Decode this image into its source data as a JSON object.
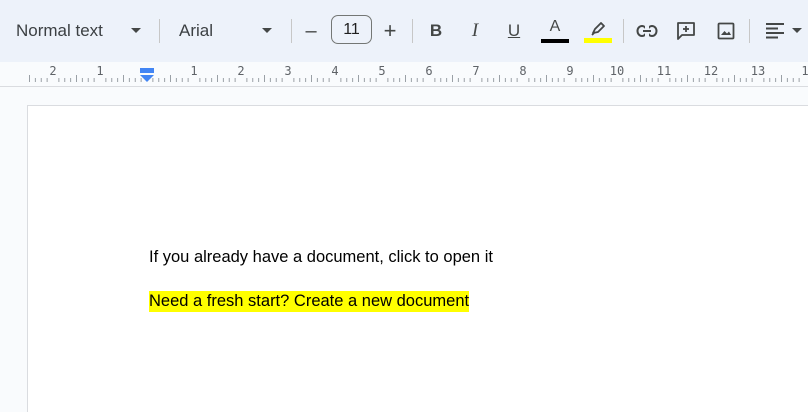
{
  "toolbar": {
    "style_dropdown": {
      "label": "Normal text"
    },
    "font_dropdown": {
      "label": "Arial"
    },
    "font_size": {
      "value": "11",
      "decrease_symbol": "–",
      "increase_symbol": "+"
    },
    "bold_label": "B",
    "italic_label": "I",
    "underline_label": "U",
    "text_color_label": "A",
    "text_color": "#000000",
    "highlight_color": "#ffff00",
    "icons": [
      "link-icon",
      "add-comment-icon",
      "insert-image-icon",
      "align-left-icon"
    ]
  },
  "ruler": {
    "numbers": [
      "2",
      "1",
      "1",
      "2",
      "3",
      "4",
      "5",
      "6",
      "7",
      "8",
      "9",
      "10",
      "11",
      "12",
      "13",
      "1"
    ]
  },
  "document": {
    "paragraphs": [
      {
        "text": "If you already have a document, click to open it",
        "highlight": null
      },
      {
        "text": "Need a fresh start? Create a new document",
        "highlight": "#ffff00"
      }
    ]
  }
}
